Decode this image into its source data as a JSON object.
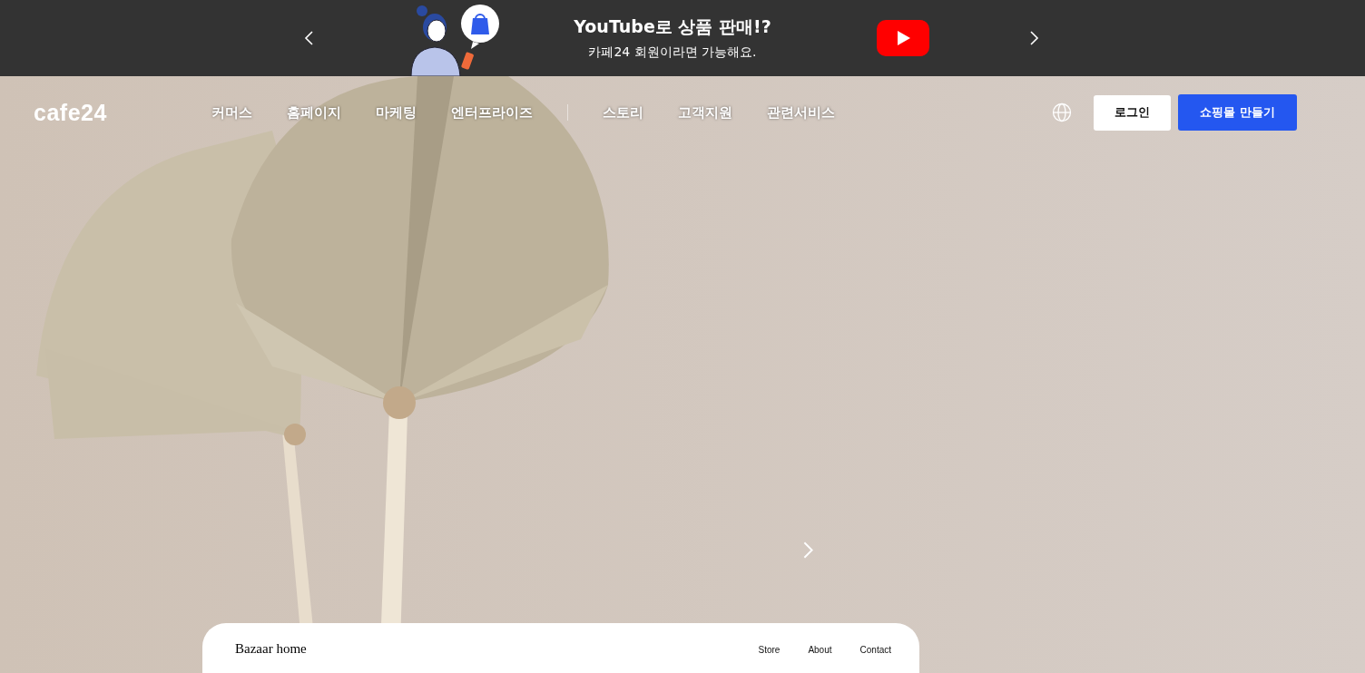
{
  "banner": {
    "title": "YouTube로 상품 판매!?",
    "subtitle": "카페24 회원이라면 가능해요."
  },
  "nav": {
    "logo": "cafe24",
    "menu_primary": [
      "커머스",
      "홈페이지",
      "마케팅",
      "엔터프라이즈"
    ],
    "menu_secondary": [
      "스토리",
      "고객지원",
      "관련서비스"
    ],
    "login": "로그인",
    "create": "쇼핑몰 만들기"
  },
  "preview_card": {
    "brand": "Bazaar home",
    "links": [
      "Store",
      "About",
      "Contact"
    ]
  }
}
